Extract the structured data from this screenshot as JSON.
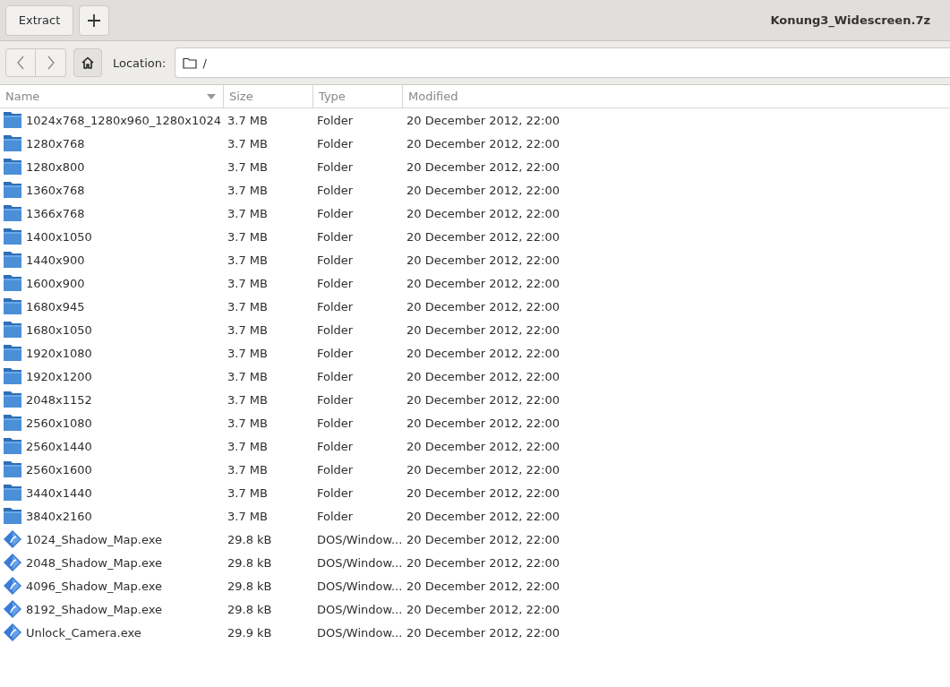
{
  "header": {
    "buttons": [
      {
        "kind": "text",
        "label": "Extract"
      },
      {
        "kind": "add"
      }
    ],
    "title": "Konung3_Widescreen.7z"
  },
  "toolbar": {
    "location_label": "Location:",
    "location": "/"
  },
  "table": {
    "columns": [
      {
        "label": "Name",
        "sorted": true
      },
      {
        "label": "Size",
        "sorted": false
      },
      {
        "label": "Type",
        "sorted": false
      },
      {
        "label": "Modified",
        "sorted": false
      }
    ],
    "rows": [
      {
        "kind": "folder",
        "name": "1024x768_1280x960_1280x1024",
        "size": "3.7 MB",
        "type": "Folder",
        "modified": "20 December 2012, 22:00"
      },
      {
        "kind": "folder",
        "name": "1280x768",
        "size": "3.7 MB",
        "type": "Folder",
        "modified": "20 December 2012, 22:00"
      },
      {
        "kind": "folder",
        "name": "1280x800",
        "size": "3.7 MB",
        "type": "Folder",
        "modified": "20 December 2012, 22:00"
      },
      {
        "kind": "folder",
        "name": "1360x768",
        "size": "3.7 MB",
        "type": "Folder",
        "modified": "20 December 2012, 22:00"
      },
      {
        "kind": "folder",
        "name": "1366x768",
        "size": "3.7 MB",
        "type": "Folder",
        "modified": "20 December 2012, 22:00"
      },
      {
        "kind": "folder",
        "name": "1400x1050",
        "size": "3.7 MB",
        "type": "Folder",
        "modified": "20 December 2012, 22:00"
      },
      {
        "kind": "folder",
        "name": "1440x900",
        "size": "3.7 MB",
        "type": "Folder",
        "modified": "20 December 2012, 22:00"
      },
      {
        "kind": "folder",
        "name": "1600x900",
        "size": "3.7 MB",
        "type": "Folder",
        "modified": "20 December 2012, 22:00"
      },
      {
        "kind": "folder",
        "name": "1680x945",
        "size": "3.7 MB",
        "type": "Folder",
        "modified": "20 December 2012, 22:00"
      },
      {
        "kind": "folder",
        "name": "1680x1050",
        "size": "3.7 MB",
        "type": "Folder",
        "modified": "20 December 2012, 22:00"
      },
      {
        "kind": "folder",
        "name": "1920x1080",
        "size": "3.7 MB",
        "type": "Folder",
        "modified": "20 December 2012, 22:00"
      },
      {
        "kind": "folder",
        "name": "1920x1200",
        "size": "3.7 MB",
        "type": "Folder",
        "modified": "20 December 2012, 22:00"
      },
      {
        "kind": "folder",
        "name": "2048x1152",
        "size": "3.7 MB",
        "type": "Folder",
        "modified": "20 December 2012, 22:00"
      },
      {
        "kind": "folder",
        "name": "2560x1080",
        "size": "3.7 MB",
        "type": "Folder",
        "modified": "20 December 2012, 22:00"
      },
      {
        "kind": "folder",
        "name": "2560x1440",
        "size": "3.7 MB",
        "type": "Folder",
        "modified": "20 December 2012, 22:00"
      },
      {
        "kind": "folder",
        "name": "2560x1600",
        "size": "3.7 MB",
        "type": "Folder",
        "modified": "20 December 2012, 22:00"
      },
      {
        "kind": "folder",
        "name": "3440x1440",
        "size": "3.7 MB",
        "type": "Folder",
        "modified": "20 December 2012, 22:00"
      },
      {
        "kind": "folder",
        "name": "3840x2160",
        "size": "3.7 MB",
        "type": "Folder",
        "modified": "20 December 2012, 22:00"
      },
      {
        "kind": "exe",
        "name": "1024_Shadow_Map.exe",
        "size": "29.8 kB",
        "type": "DOS/Window...",
        "modified": "20 December 2012, 22:00"
      },
      {
        "kind": "exe",
        "name": "2048_Shadow_Map.exe",
        "size": "29.8 kB",
        "type": "DOS/Window...",
        "modified": "20 December 2012, 22:00"
      },
      {
        "kind": "exe",
        "name": "4096_Shadow_Map.exe",
        "size": "29.8 kB",
        "type": "DOS/Window...",
        "modified": "20 December 2012, 22:00"
      },
      {
        "kind": "exe",
        "name": "8192_Shadow_Map.exe",
        "size": "29.8 kB",
        "type": "DOS/Window...",
        "modified": "20 December 2012, 22:00"
      },
      {
        "kind": "exe",
        "name": "Unlock_Camera.exe",
        "size": "29.9 kB",
        "type": "DOS/Window...",
        "modified": "20 December 2012, 22:00"
      }
    ]
  }
}
